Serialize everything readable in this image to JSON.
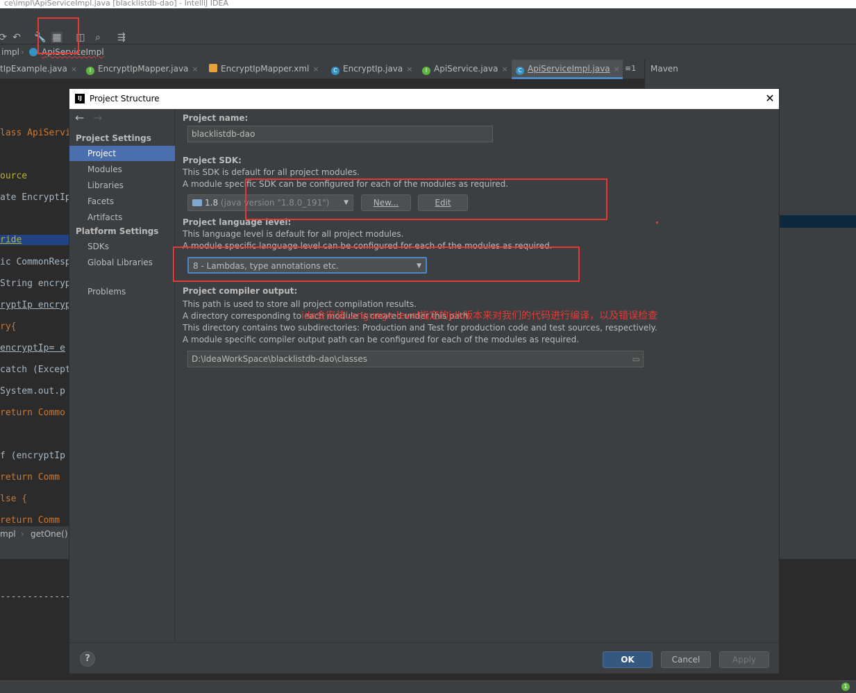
{
  "window": {
    "title": "ce\\impl\\ApiServiceImpl.java [blacklistdb-dao] - IntelliJ IDEA"
  },
  "breadcrumb": {
    "items": [
      "impl",
      "ApiServiceImpl"
    ]
  },
  "editor_tabs": [
    {
      "label": "tIpExample.java",
      "icon": "class-icon"
    },
    {
      "label": "EncryptIpMapper.java",
      "icon": "interface-icon"
    },
    {
      "label": "EncryptIpMapper.xml",
      "icon": "xml-icon"
    },
    {
      "label": "EncryptIp.java",
      "icon": "class-icon"
    },
    {
      "label": "ApiService.java",
      "icon": "interface-icon"
    },
    {
      "label": "ApiServiceImpl.java",
      "icon": "class-icon",
      "active": true
    }
  ],
  "tabs_overflow": "≡1",
  "maven_panel": {
    "title": "Maven"
  },
  "code_crumb": {
    "items": [
      "mpl",
      "getOne()"
    ]
  },
  "code_lines": {
    "l1": "lass ApiServi",
    "l2": "ource",
    "l3": "ate EncryptIp",
    "l4": "ride",
    "l5": "ic CommonResp",
    "l6": "String encryp",
    "l7": "ryptIp encryp",
    "l8": "ry{",
    "l9": " encryptIp= e",
    "l10": "catch (Except",
    "l11": " System.out.p",
    "l12": " return Commo",
    "l13": "f (encryptIp",
    "l14": "  return Comm",
    "l15": "lse {",
    "l16": "  return Comm"
  },
  "dashes": "-------------",
  "dialog": {
    "title": "Project Structure",
    "sidebar": {
      "project_settings_header": "Project Settings",
      "project_settings_items": [
        "Project",
        "Modules",
        "Libraries",
        "Facets",
        "Artifacts"
      ],
      "platform_settings_header": "Platform Settings",
      "platform_settings_items": [
        "SDKs",
        "Global Libraries"
      ],
      "problems": "Problems"
    },
    "content": {
      "project_name_label": "Project name:",
      "project_name_value": "blacklistdb-dao",
      "sdk_label": "Project SDK:",
      "sdk_desc1": "This SDK is default for all project modules.",
      "sdk_desc2": "A module specific SDK can be configured for each of the modules as required.",
      "sdk_selected_version": "1.8",
      "sdk_selected_detail": "(java version \"1.8.0_191\")",
      "sdk_new_button": "New...",
      "sdk_edit_button": "Edit",
      "lang_label": "Project language level:",
      "lang_desc1": "This language level is default for all project modules.",
      "lang_desc2": "A module specific language level can be configured for each of the modules as required.",
      "lang_selected": "8 - Lambdas, type annotations etc.",
      "compiler_label": "Project compiler output:",
      "compiler_desc1": "This path is used to store all project compilation results.",
      "compiler_desc2": "A directory corresponding to each module is created under this path.",
      "compiler_desc3": "This directory contains two subdirectories: Production and Test for production code and test sources, respectively.",
      "compiler_desc4": "A module specific compiler output path can be configured for each of the modules as required.",
      "compiler_path": "D:\\IdeaWorkSpace\\blacklistdb-dao\\classes"
    },
    "footer": {
      "help": "?",
      "ok": "OK",
      "cancel": "Cancel",
      "apply": "Apply"
    }
  },
  "annotation_text": "ide会安装Language level指定的jdk版本来对我们的代码进行编译，以及错误检查",
  "colors": {
    "annotation_red": "#e53935",
    "selection_blue": "#4b6eaf",
    "ok_blue": "#365880"
  }
}
